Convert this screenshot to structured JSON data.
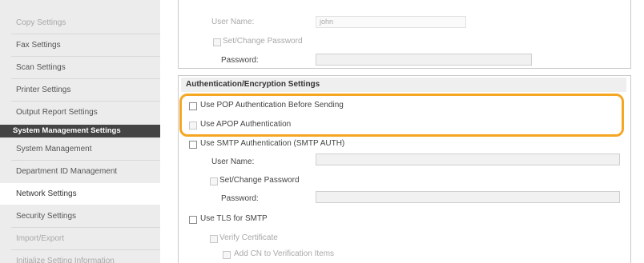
{
  "sidebar": {
    "items": [
      {
        "label": "Copy Settings"
      },
      {
        "label": "Fax Settings"
      },
      {
        "label": "Scan Settings"
      },
      {
        "label": "Printer Settings"
      },
      {
        "label": "Output Report Settings"
      },
      {
        "label": "System Management Settings"
      },
      {
        "label": "System Management"
      },
      {
        "label": "Department ID Management"
      },
      {
        "label": "Network Settings"
      },
      {
        "label": "Security Settings"
      },
      {
        "label": "Import/Export"
      },
      {
        "label": "Initialize Setting Information"
      }
    ]
  },
  "top_section": {
    "user_name_label": "User Name:",
    "user_name_value": "john",
    "set_change_password_label": "Set/Change Password",
    "password_label": "Password:"
  },
  "auth": {
    "title": "Authentication/Encryption Settings",
    "pop_before_sending_label": "Use POP Authentication Before Sending",
    "apop_label": "Use APOP Authentication",
    "smtp_auth_label": "Use SMTP Authentication (SMTP AUTH)",
    "user_name_label": "User Name:",
    "set_change_password_label": "Set/Change Password",
    "password_label": "Password:",
    "tls_label": "Use TLS for SMTP",
    "verify_certificate_label": "Verify Certificate",
    "add_cn_label": "Add CN to Verification Items"
  },
  "colors": {
    "highlight": "#f5a623",
    "sidebar_background": "#ececec",
    "section_header_background": "#444444"
  }
}
